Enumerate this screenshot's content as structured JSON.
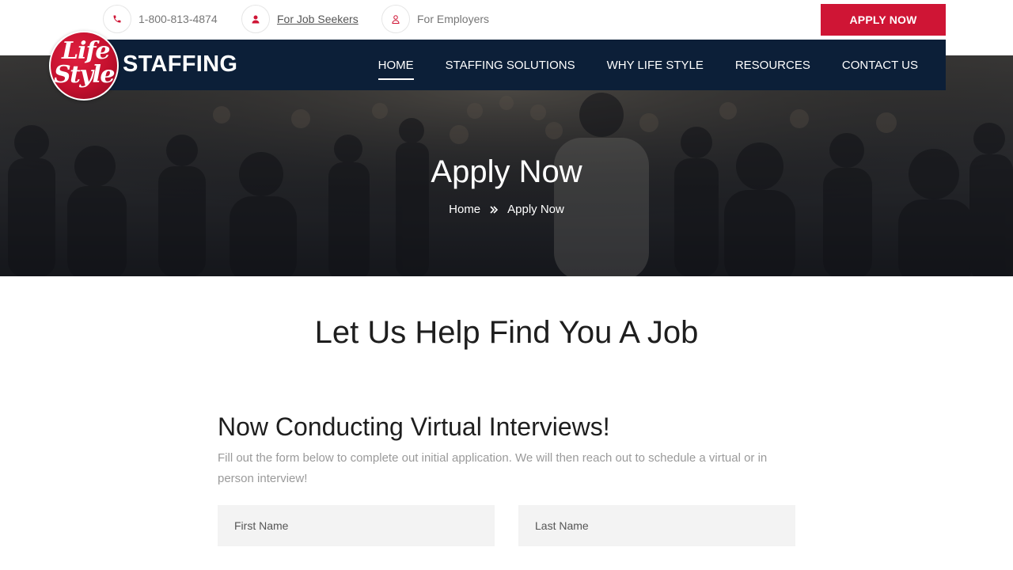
{
  "topbar": {
    "phone": "1-800-813-4874",
    "job_seekers": "For Job Seekers",
    "employers": "For Employers",
    "apply_button": "APPLY NOW"
  },
  "brand": {
    "logo_line1": "Life",
    "logo_line2": "Style",
    "name": "STAFFING"
  },
  "nav": {
    "items": [
      {
        "label": "HOME",
        "active": true
      },
      {
        "label": "STAFFING SOLUTIONS"
      },
      {
        "label": "WHY LIFE STYLE"
      },
      {
        "label": "RESOURCES"
      },
      {
        "label": "CONTACT US"
      }
    ]
  },
  "hero": {
    "title": "Apply Now",
    "breadcrumb": [
      "Home",
      "Apply Now"
    ]
  },
  "main": {
    "section_title": "Let Us Help Find You A Job",
    "form_heading": "Now Conducting Virtual Interviews!",
    "form_description": "Fill out the form below to complete out initial application. We will then reach out to schedule a virtual or in person interview!",
    "fields": {
      "first_name_placeholder": "First Name",
      "last_name_placeholder": "Last Name"
    }
  },
  "colors": {
    "accent": "#cf1535",
    "navbar": "#0c1f38",
    "icon": "#cf1535"
  },
  "icons": [
    "phone-icon",
    "user-icon",
    "user-outline-icon",
    "double-chevron-right-icon"
  ]
}
